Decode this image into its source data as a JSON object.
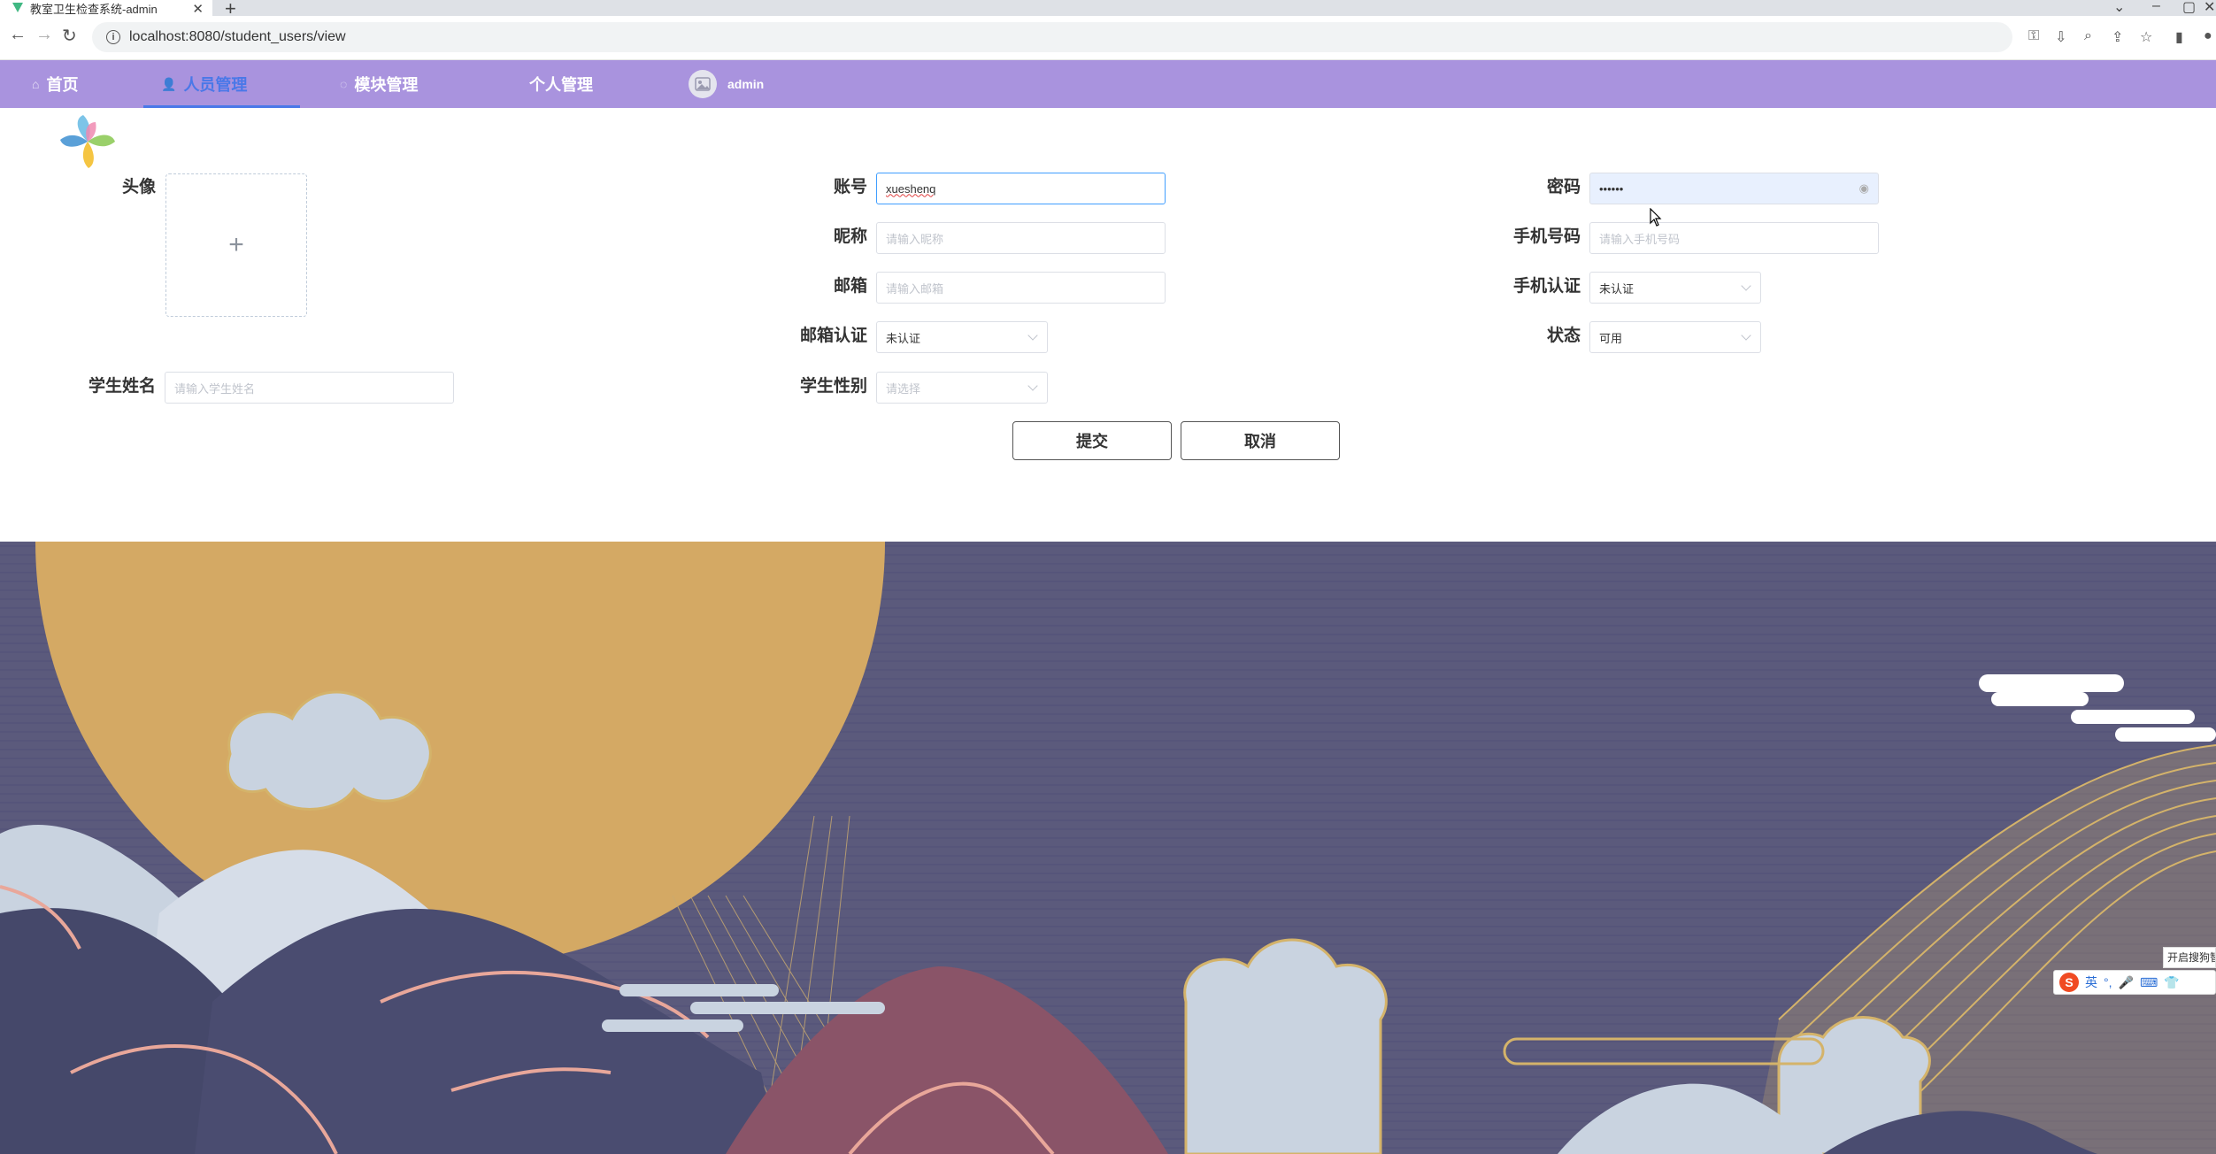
{
  "browser": {
    "tab_title": "教室卫生检查系统-admin",
    "url": "localhost:8080/student_users/view"
  },
  "nav": {
    "items": [
      {
        "label": "首页",
        "icon": "home-icon"
      },
      {
        "label": "人员管理",
        "icon": "user-icon",
        "active": true
      },
      {
        "label": "模块管理",
        "icon": "chat-icon"
      },
      {
        "label": "个人管理",
        "icon": ""
      }
    ],
    "user": "admin"
  },
  "form": {
    "avatar_label": "头像",
    "account_label": "账号",
    "account_value": "xueshenq",
    "password_label": "密码",
    "password_value": "••••••",
    "nickname_label": "昵称",
    "nickname_placeholder": "请输入昵称",
    "phone_label": "手机号码",
    "phone_placeholder": "请输入手机号码",
    "email_label": "邮箱",
    "email_placeholder": "请输入邮箱",
    "phone_verify_label": "手机认证",
    "phone_verify_value": "未认证",
    "email_verify_label": "邮箱认证",
    "email_verify_value": "未认证",
    "status_label": "状态",
    "status_value": "可用",
    "student_name_label": "学生姓名",
    "student_name_placeholder": "请输入学生姓名",
    "gender_label": "学生性别",
    "gender_placeholder": "请选择",
    "submit_label": "提交",
    "cancel_label": "取消"
  },
  "ime": {
    "lang": "英",
    "tip": "开启搜狗智"
  },
  "colors": {
    "nav_bg": "#a993de",
    "nav_active": "#4a78e8",
    "scene_bg": "#5b5a7c",
    "moon": "#d4a964"
  }
}
